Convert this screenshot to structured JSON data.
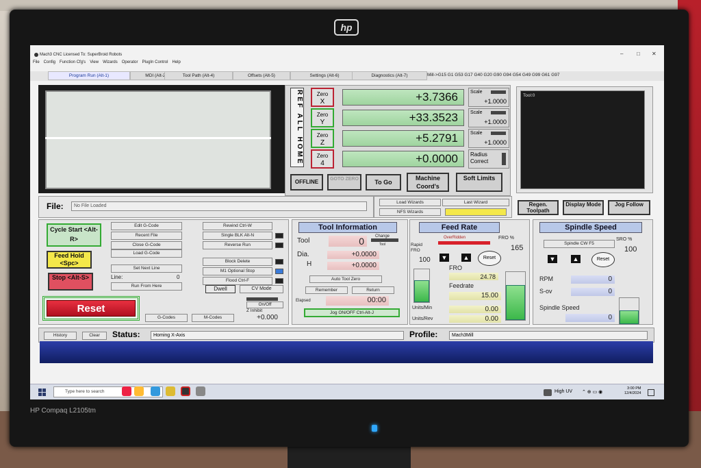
{
  "colors": {
    "accent": "#1a3a9a",
    "dro_green": "#9fd49f",
    "alarm_red": "#d8202a",
    "cycle_green": "#3a3",
    "feed_yellow": "#f4e84a"
  },
  "monitor": {
    "logo": "hp",
    "brand": "HP Compaq L2105tm"
  },
  "window": {
    "title": "Mach3 CNC  Licensed To: SuperBroid Robots",
    "controls": [
      "–",
      "□",
      "✕"
    ]
  },
  "menu": [
    "File",
    "Config",
    "Function Cfg's",
    "View",
    "Wizards",
    "Operator",
    "PlugIn Control",
    "Help"
  ],
  "tabs": [
    "Program Run (Alt-1)",
    "MDI (Alt-2)",
    "Tool Path (Alt-4)",
    "Offsets (Alt-5)",
    "Settings (Alt-6)",
    "Diagnostics (Alt-7)"
  ],
  "gcodes_active": "Mill->G15  G1 G53 G17 G40 G20 G90 G94 G54 G49 G99 G61 G97",
  "ref_all_home": "REF ALL HOME",
  "axes": [
    {
      "zero": "Zero",
      "axis": "X",
      "value": "+3.7366",
      "scale_label": "Scale",
      "scale": "+1.0000"
    },
    {
      "zero": "Zero",
      "axis": "Y",
      "value": "+33.3523",
      "scale_label": "Scale",
      "scale": "+1.0000"
    },
    {
      "zero": "Zero",
      "axis": "Z",
      "value": "+5.2791",
      "scale_label": "Scale",
      "scale": "+1.0000"
    },
    {
      "zero": "Zero",
      "axis": "4",
      "value": "+0.0000",
      "scale_label": "Radius",
      "scale": "Correct"
    }
  ],
  "dro_buttons": {
    "offline": "OFFLINE",
    "gotoz": "GOTO ZERO",
    "togo": "To Go",
    "machine": "Machine Coord's",
    "soft": "Soft Limits"
  },
  "toolpath": {
    "label": "Tool:0",
    "regen": "Regen. Toolpath",
    "display": "Display Mode",
    "jog": "Jog Follow"
  },
  "file": {
    "label": "File:",
    "value": "No File Loaded",
    "load_wizards": "Load Wizards",
    "last_wizard": "Last Wizard",
    "nfs_wizards": "NFS Wizards"
  },
  "program": {
    "cycle_start": "Cycle Start <Alt-R>",
    "feed_hold": "Feed Hold <Spc>",
    "stop": "Stop <Alt-S>",
    "reset": "Reset",
    "col1": [
      "Edit G-Code",
      "Recent File",
      "Close G-Code",
      "Load G-Code",
      "Set Next Line",
      "Run From Here"
    ],
    "col2": [
      "Rewind Ctrl-W",
      "Single BLK Alt-N",
      "Reverse Run",
      "Block Delete",
      "M1 Optional Stop",
      "Flood Ctrl-F"
    ],
    "line_label": "Line:",
    "line_value": "0",
    "dwell": "Dwell",
    "cv_mode": "CV Mode",
    "onoff": "On/Off",
    "z_inhibit": "Z Inhibit",
    "z_value": "+0.000",
    "gcodes_btn": "G-Codes",
    "mcodes_btn": "M-Codes"
  },
  "tool_info": {
    "header": "Tool Information",
    "tool_label": "Tool",
    "tool_value": "0",
    "change": "Change",
    "tool_small": "Tool",
    "dia_label": "Dia.",
    "dia_value": "+0.0000",
    "h_label": "H",
    "h_value": "+0.0000",
    "auto_zero": "Auto Tool Zero",
    "remember": "Remember",
    "return": "Return",
    "elapsed_label": "Elapsed",
    "elapsed_value": "00:00",
    "jog": "Jog ON/OFF Ctrl-Alt-J"
  },
  "feed": {
    "header": "Feed Rate",
    "overridden": "OverRidden",
    "fro_pct_label": "FRO %",
    "fro_pct": "165",
    "rapid_label": "Rapid FRO",
    "rapid_value": "100",
    "reset": "Reset",
    "fro_label": "FRO",
    "fro_value": "24.78",
    "feedrate_label": "Feedrate",
    "feedrate_value": "15.00",
    "upm_label": "Units/Min",
    "upm_value": "0.00",
    "upr_label": "Units/Rev",
    "upr_value": "0.00",
    "fro_fill": 0.75,
    "rapid_fill": 0.7
  },
  "spindle": {
    "header": "Spindle Speed",
    "cw": "Spindle CW F5",
    "sro_label": "SRO %",
    "sro_value": "100",
    "reset": "Reset",
    "rpm_label": "RPM",
    "rpm_value": "0",
    "sov_label": "S-ov",
    "sov_value": "0",
    "speed_label": "Spindle Speed",
    "speed_value": "0",
    "speed_fill": 0.55
  },
  "status": {
    "history": "History",
    "clear": "Clear",
    "label": "Status:",
    "value": "Homing X-Axis",
    "profile_label": "Profile:",
    "profile_value": "Mach3Mill"
  },
  "taskbar": {
    "search": "Type here to search",
    "weather": "High UV",
    "time": "3:00 PM",
    "date": "12/4/2024"
  }
}
